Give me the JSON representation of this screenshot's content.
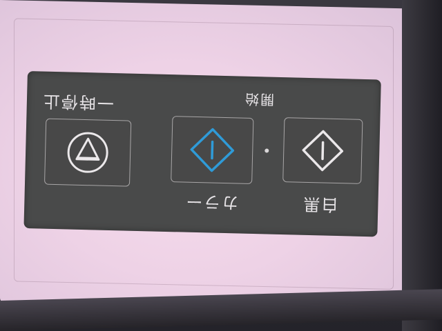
{
  "panel": {
    "label_pause": "一時停止",
    "label_start": "開始",
    "label_color": "カラー",
    "label_bw": "白黒"
  },
  "icons": {
    "pause": "triangle-in-circle-icon",
    "color": "diamond-bar-icon",
    "bw": "diamond-bar-icon"
  },
  "colors": {
    "panel": "#494a4a",
    "color_icon": "#2f9bd8",
    "bw_icon": "#ebe8ea",
    "sticker": "#f1d6e8"
  }
}
